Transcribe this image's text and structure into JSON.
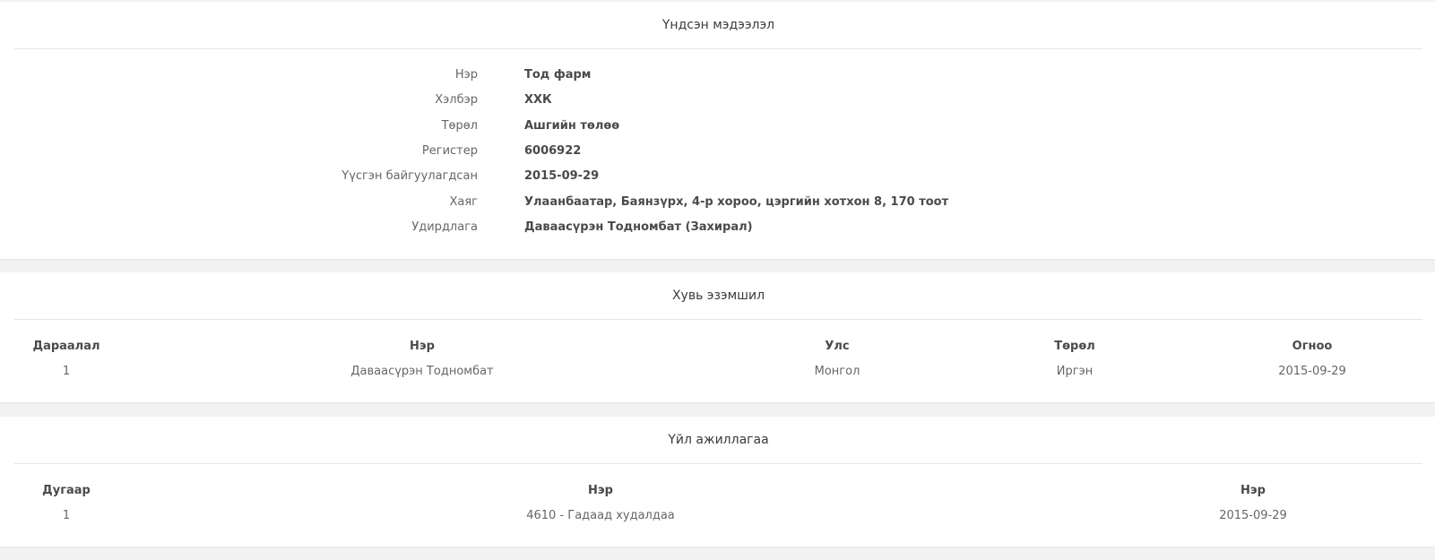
{
  "basic_info": {
    "title": "Үндсэн мэдээлэл",
    "rows": [
      {
        "label": "Нэр",
        "value": "Тод фарм"
      },
      {
        "label": "Хэлбэр",
        "value": "ХХК"
      },
      {
        "label": "Төрөл",
        "value": "Ашгийн төлөө"
      },
      {
        "label": "Регистер",
        "value": "6006922"
      },
      {
        "label": "Үүсгэн байгуулагдсан",
        "value": "2015-09-29"
      },
      {
        "label": "Хаяг",
        "value": "Улаанбаатар, Баянзүрх, 4-р хороо, цэргийн хотхон 8, 170 тоот"
      },
      {
        "label": "Удирдлага",
        "value": "Даваасүрэн Тодномбат (Захирал)"
      }
    ]
  },
  "ownership": {
    "title": "Хувь эзэмшил",
    "headers": [
      "Дараалал",
      "Нэр",
      "Улс",
      "Төрөл",
      "Огноо"
    ],
    "rows": [
      [
        "1",
        "Даваасүрэн Тодномбат",
        "Монгол",
        "Иргэн",
        "2015-09-29"
      ]
    ]
  },
  "activity": {
    "title": "Үйл ажиллагаа",
    "headers": [
      "Дугаар",
      "Нэр",
      "Нэр"
    ],
    "rows": [
      [
        "1",
        "4610 - Гадаад худалдаа",
        "2015-09-29"
      ]
    ]
  }
}
